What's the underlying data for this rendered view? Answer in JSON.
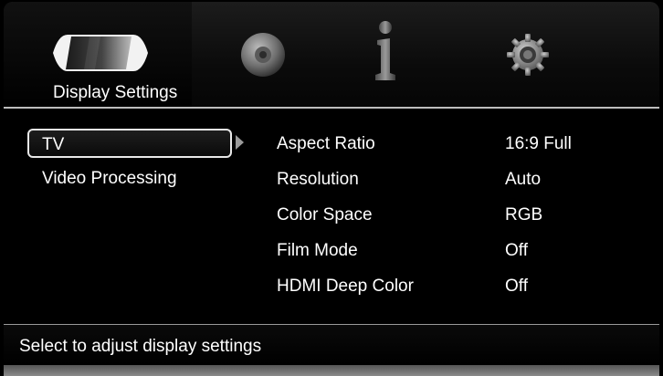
{
  "tabs": [
    {
      "icon": "display-icon",
      "label": "Display Settings",
      "active": true
    },
    {
      "icon": "audio-disc-icon",
      "label": ""
    },
    {
      "icon": "info-icon",
      "label": ""
    },
    {
      "icon": "gear-icon",
      "label": ""
    }
  ],
  "categories": [
    {
      "label": "TV",
      "selected": true
    },
    {
      "label": "Video Processing",
      "selected": false
    }
  ],
  "settings": [
    {
      "name": "Aspect Ratio",
      "value": "16:9 Full"
    },
    {
      "name": "Resolution",
      "value": "Auto"
    },
    {
      "name": "Color Space",
      "value": "RGB"
    },
    {
      "name": "Film Mode",
      "value": "Off"
    },
    {
      "name": "HDMI Deep Color",
      "value": "Off"
    }
  ],
  "status": {
    "text": "Select to adjust display settings"
  },
  "colors": {
    "background": "#000000",
    "text": "#ffffff",
    "divider": "#bdbdbd",
    "selection_border": "#e8e8e8"
  }
}
